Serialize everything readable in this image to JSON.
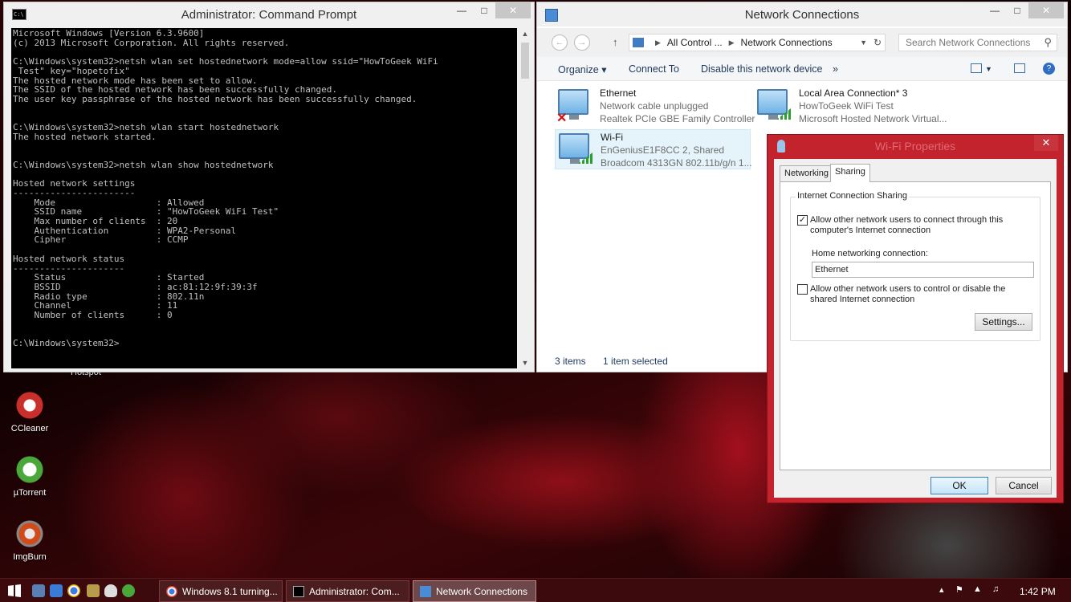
{
  "desktop": {
    "hotspot_label": "Hotspot",
    "icons": [
      {
        "label": "CCleaner",
        "icon": "ccleaner-icon",
        "color": "#c9302c"
      },
      {
        "label": "µTorrent",
        "icon": "utorrent-icon",
        "color": "#4aa83a"
      },
      {
        "label": "ImgBurn",
        "icon": "imgburn-icon",
        "color": "#d04a1a"
      }
    ]
  },
  "cmd": {
    "title": "Administrator: Command Prompt",
    "lines": [
      "Microsoft Windows [Version 6.3.9600]",
      "(c) 2013 Microsoft Corporation. All rights reserved.",
      "",
      "C:\\Windows\\system32>netsh wlan set hostednetwork mode=allow ssid=\"HowToGeek WiFi",
      " Test\" key=\"hopetofix\"",
      "The hosted network mode has been set to allow.",
      "The SSID of the hosted network has been successfully changed.",
      "The user key passphrase of the hosted network has been successfully changed.",
      "",
      "",
      "C:\\Windows\\system32>netsh wlan start hostednetwork",
      "The hosted network started.",
      "",
      "",
      "C:\\Windows\\system32>netsh wlan show hostednetwork",
      "",
      "Hosted network settings",
      "-----------------------",
      "    Mode                   : Allowed",
      "    SSID name              : \"HowToGeek WiFi Test\"",
      "    Max number of clients  : 20",
      "    Authentication         : WPA2-Personal",
      "    Cipher                 : CCMP",
      "",
      "Hosted network status",
      "---------------------",
      "    Status                 : Started",
      "    BSSID                  : ac:81:12:9f:39:3f",
      "    Radio type             : 802.11n",
      "    Channel                : 11",
      "    Number of clients      : 0",
      "",
      "",
      "C:\\Windows\\system32>"
    ]
  },
  "netconn": {
    "title": "Network Connections",
    "breadcrumb": [
      "All Control ...",
      "Network Connections"
    ],
    "search_placeholder": "Search Network Connections",
    "toolbar": {
      "organize": "Organize ▾",
      "connect_to": "Connect To",
      "disable": "Disable this network device",
      "more": "»"
    },
    "items": [
      {
        "name": "Ethernet",
        "line2": "Network cable unplugged",
        "line3": "Realtek PCIe GBE Family Controller",
        "state": "unplugged"
      },
      {
        "name": "Local Area Connection* 3",
        "line2": "HowToGeek WiFi Test",
        "line3": "Microsoft Hosted Network Virtual...",
        "state": "connected"
      },
      {
        "name": "Wi-Fi",
        "line2": "EnGeniusE1F8CC  2, Shared",
        "line3": "Broadcom 4313GN 802.11b/g/n 1...",
        "state": "selected"
      }
    ],
    "status": {
      "count": "3 items",
      "selected": "1 item selected"
    }
  },
  "dialog": {
    "title": "Wi-Fi Properties",
    "tabs": [
      "Networking",
      "Sharing"
    ],
    "group_label": "Internet Connection Sharing",
    "allow_connect_label": "Allow other network users to connect through this computer's Internet connection",
    "allow_connect_checked": true,
    "home_label": "Home networking connection:",
    "home_value": "Ethernet",
    "allow_control_label": "Allow other network users to control or disable the shared Internet connection",
    "allow_control_checked": false,
    "settings_label": "Settings...",
    "ok_label": "OK",
    "cancel_label": "Cancel"
  },
  "taskbar": {
    "tasks": [
      {
        "label": "Windows 8.1 turning...",
        "icon": "chrome-icon"
      },
      {
        "label": "Administrator: Com...",
        "icon": "cmd-icon"
      },
      {
        "label": "Network Connections",
        "icon": "network-connections-icon"
      }
    ],
    "clock": "1:42 PM",
    "more": "▴"
  }
}
